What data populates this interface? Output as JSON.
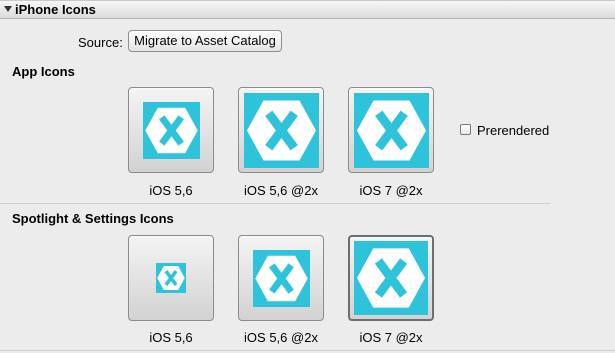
{
  "header": {
    "title": "iPhone Icons"
  },
  "source": {
    "label": "Source:",
    "button_label": "Migrate to Asset Catalog"
  },
  "app_icons": {
    "title": "App Icons",
    "items": [
      {
        "label": "iOS 5,6"
      },
      {
        "label": "iOS 5,6 @2x"
      },
      {
        "label": "iOS 7 @2x"
      }
    ],
    "prerendered_label": "Prerendered",
    "prerendered_checked": false
  },
  "spotlight_icons": {
    "title": "Spotlight & Settings Icons",
    "items": [
      {
        "label": "iOS 5,6"
      },
      {
        "label": "iOS 5,6 @2x"
      },
      {
        "label": "iOS 7 @2x"
      }
    ]
  },
  "icon": {
    "name": "xamarin-hexagon-x-icon",
    "color": "#2fc3db"
  }
}
